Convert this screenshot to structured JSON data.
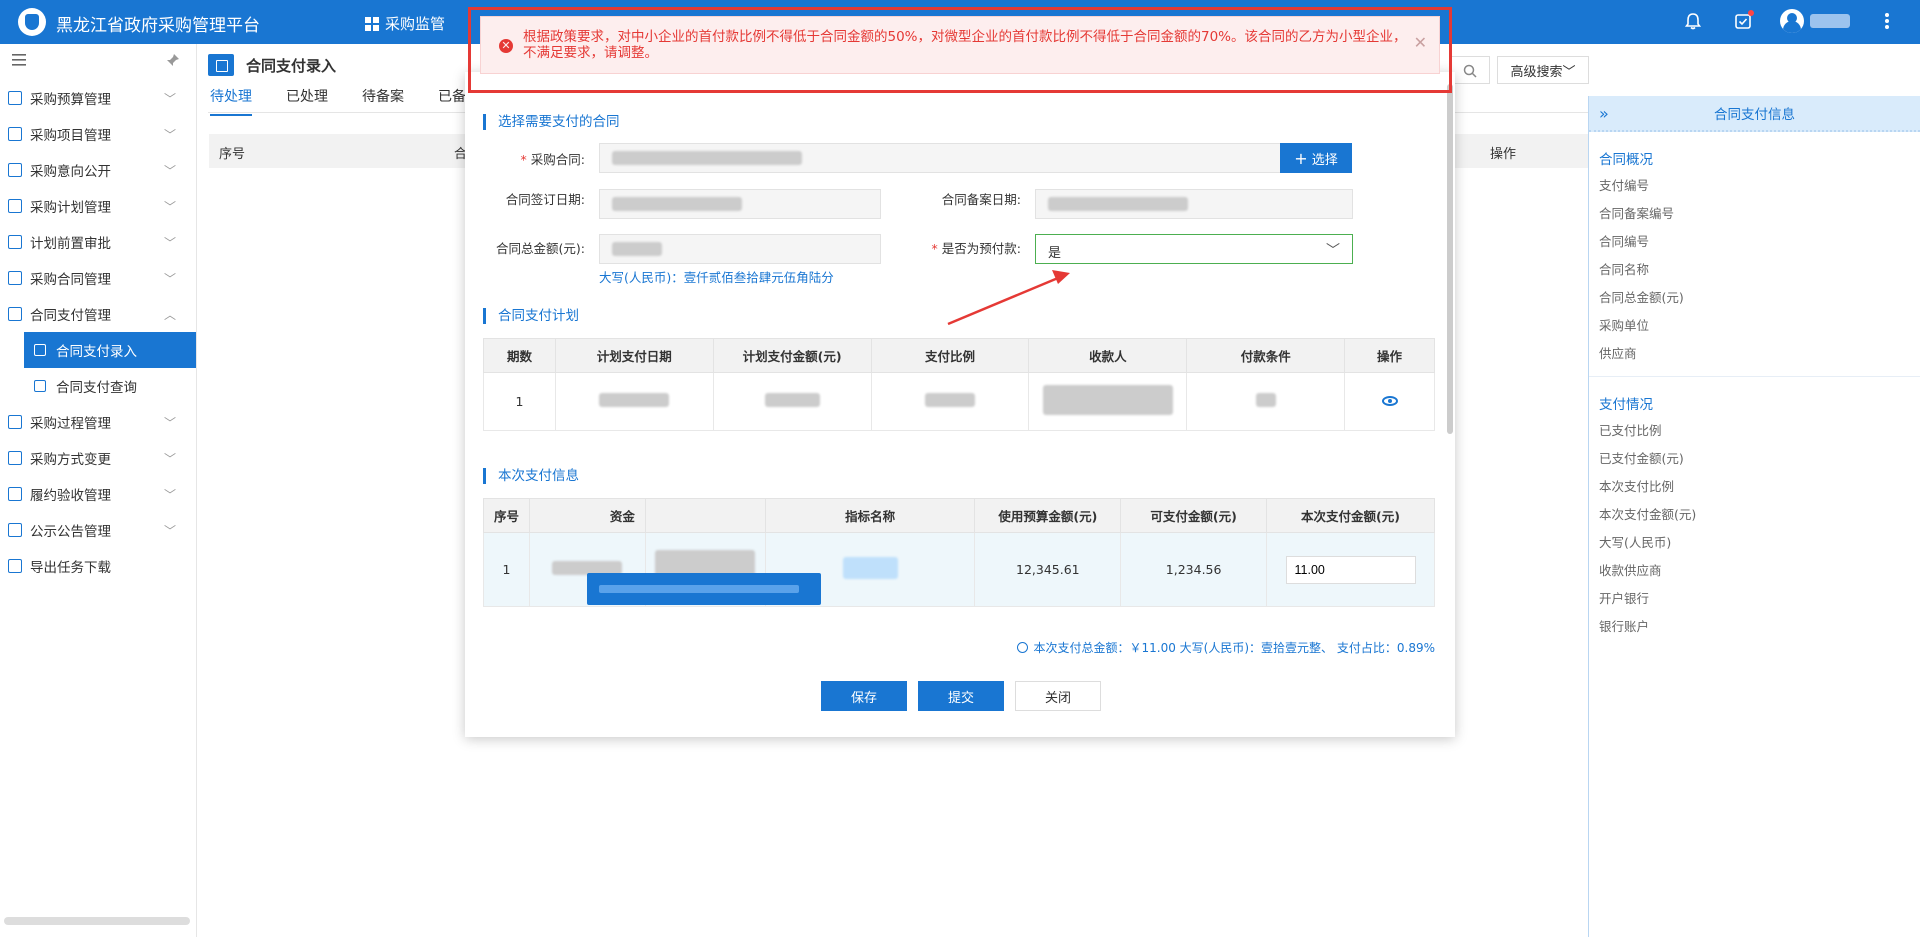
{
  "app": {
    "title": "黑龙江省政府采购管理平台"
  },
  "topnav": {
    "item1": "采购监管"
  },
  "sidebar": {
    "items": [
      {
        "label": "采购预算管理"
      },
      {
        "label": "采购项目管理"
      },
      {
        "label": "采购意向公开"
      },
      {
        "label": "采购计划管理"
      },
      {
        "label": "计划前置审批"
      },
      {
        "label": "采购合同管理"
      },
      {
        "label": "合同支付管理"
      },
      {
        "label": "采购过程管理"
      },
      {
        "label": "采购方式变更"
      },
      {
        "label": "履约验收管理"
      },
      {
        "label": "公示公告管理"
      },
      {
        "label": "导出任务下载"
      }
    ],
    "sub_items": [
      {
        "label": "合同支付录入"
      },
      {
        "label": "合同支付查询"
      }
    ]
  },
  "page": {
    "title": "合同支付录入",
    "tabs": [
      "待处理",
      "已处理",
      "待备案",
      "已备"
    ],
    "table_headers": {
      "no": "序号",
      "contract": "合",
      "ops": "操作"
    },
    "adv_search": "高级搜索"
  },
  "message": {
    "text": "根据政策要求，对中小企业的首付款比例不得低于合同金额的50%，对微型企业的首付款比例不得低于合同金额的70%。该合同的乙方为小型企业，不满足要求，请调整。"
  },
  "dialog": {
    "sec1": "选择需要支付的合同",
    "contract_label": "采购合同:",
    "select_btn": "选择",
    "sign_date_label": "合同签订日期:",
    "record_date_label": "合同备案日期:",
    "amount_label": "合同总金额(元):",
    "prepay_label": "是否为预付款:",
    "prepay_value": "是",
    "amount_words": "大写(人民币)：壹仟贰佰叁拾肆元伍角陆分",
    "sec2": "合同支付计划",
    "plan_headers": [
      "期数",
      "计划支付日期",
      "计划支付金额(元)",
      "支付比例",
      "收款人",
      "付款条件",
      "操作"
    ],
    "plan_rows": [
      {
        "no": "1"
      }
    ],
    "sec3": "本次支付信息",
    "pay_headers": {
      "no": "序号",
      "fund": "资金",
      "indicator": "指标名称",
      "budget": "使用预算金额(元)",
      "payable": "可支付金额(元)",
      "this_pay": "本次支付金额(元)"
    },
    "pay_rows": [
      {
        "no": "1",
        "budget": "12,345.61",
        "payable": "1,234.56",
        "this_pay": "11.00"
      }
    ],
    "summary": "本次支付总金额：￥11.00 大写(人民币)：壹拾壹元整、 支付占比：0.89%",
    "btn_save": "保存",
    "btn_submit": "提交",
    "btn_close": "关闭"
  },
  "right_panel": {
    "title": "合同支付信息",
    "sec1": "合同概况",
    "sec1_rows": [
      "支付编号",
      "合同备案编号",
      "合同编号",
      "合同名称",
      "合同总金额(元)",
      "采购单位",
      "供应商"
    ],
    "sec2": "支付情况",
    "sec2_rows": [
      "已支付比例",
      "已支付金额(元)",
      "本次支付比例",
      "本次支付金额(元)",
      "大写(人民币)",
      "收款供应商",
      "开户银行",
      "银行账户"
    ]
  },
  "colors": {
    "primary": "#1976d2",
    "error": "#e53935",
    "error_bg": "#fdeeee"
  }
}
